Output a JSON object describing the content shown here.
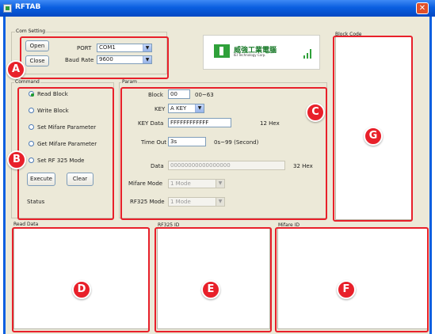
{
  "window": {
    "title": "RFTAB",
    "close_glyph": "✕"
  },
  "com_setting": {
    "group_label": "Com Setting",
    "open_label": "Open",
    "close_label": "Close",
    "port_label": "PORT",
    "port_value": "COM1",
    "baud_label": "Baud Rate",
    "baud_value": "9600"
  },
  "logo": {
    "chinese": "威強工業電腦",
    "english": "IEI Technology Corp."
  },
  "command": {
    "group_label": "Command",
    "radios": [
      {
        "label": "Read Block",
        "selected": true
      },
      {
        "label": "Write Block",
        "selected": false
      },
      {
        "label": "Set Mifare Parameter",
        "selected": false
      },
      {
        "label": "Get Mifare Parameter",
        "selected": false
      },
      {
        "label": "Set RF 325 Mode",
        "selected": false
      }
    ],
    "execute_label": "Execute",
    "clear_label": "Clear",
    "status_label": "Status"
  },
  "param": {
    "group_label": "Param",
    "block_label": "Block",
    "block_value": "00",
    "block_hint": "00~63",
    "key_label": "KEY",
    "key_value": "A KEY",
    "key_data_label": "KEY Data",
    "key_data_value": "FFFFFFFFFFFF",
    "key_data_hint": "12 Hex",
    "timeout_label": "Time Out",
    "timeout_value": "3s",
    "timeout_hint": "0s~99 (Second)",
    "data_label": "Data",
    "data_value": "00000000000000000",
    "data_hint": "32 Hex",
    "mifare_mode_label": "Mifare Mode",
    "mifare_mode_value": "1 Mode",
    "rf325_mode_label": "RF325 Mode",
    "rf325_mode_value": "1 Mode"
  },
  "panels": {
    "block_code": "Block Code",
    "read_data": "Read Data",
    "rf325_id": "RF325 ID",
    "mifare_id": "Mifare ID"
  },
  "callouts": [
    "A",
    "B",
    "C",
    "D",
    "E",
    "F",
    "G"
  ],
  "colors": {
    "callout": "#e8202a",
    "titlebar": "#0a5fe0",
    "window_bg": "#ece9d8",
    "logo_green": "#2fa13a"
  }
}
